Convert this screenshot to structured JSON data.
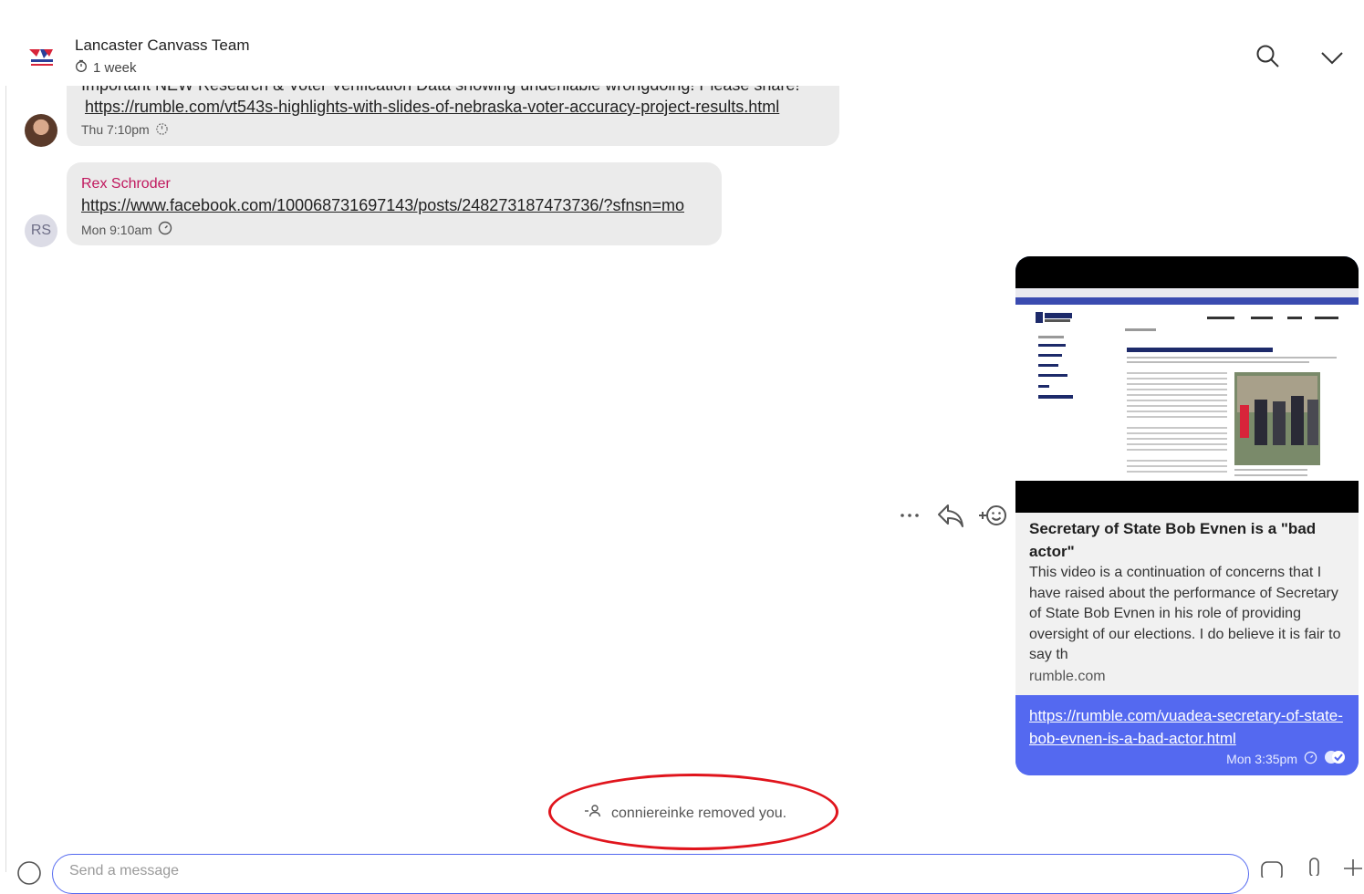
{
  "header": {
    "group_name": "Lancaster Canvass Team",
    "disappearing_timer": "1 week"
  },
  "messages": [
    {
      "text_partial": "Important NEW Research & Voter Verification Data showing undeniable wrongdoing! Please share!",
      "link": "https://rumble.com/vt543s-highlights-with-slides-of-nebraska-voter-accuracy-project-results.html",
      "time": "Thu 7:10pm"
    },
    {
      "sender": "Rex Schroder",
      "avatar_initials": "RS",
      "link": "https://www.facebook.com/100068731697143/posts/248273187473736/?sfnsn=mo",
      "time": "Mon 9:10am"
    }
  ],
  "outgoing": {
    "preview_title": "Secretary of State Bob Evnen is a \"bad actor\"",
    "preview_description": "This video is a continuation of concerns that I have raised about the performance of Secretary of State Bob Evnen in his role of providing oversight of our elections. I do believe it is fair to say th",
    "preview_domain": "rumble.com",
    "link": "https://rumble.com/vuadea-secretary-of-state-bob-evnen-is-a-bad-actor.html",
    "time": "Mon 3:35pm"
  },
  "system_notice": "conniereinke removed you.",
  "composer": {
    "placeholder": "Send a message"
  },
  "icons": {
    "search": "search-icon",
    "chevron": "chevron-down-icon",
    "more": "more-icon",
    "reply": "reply-icon",
    "react": "add-reaction-icon",
    "timer": "timer-icon",
    "delivered": "read-check-icon",
    "removed": "person-removed-icon",
    "emoji": "emoji-icon",
    "sticker": "sticker-icon",
    "mic": "mic-icon",
    "attach": "plus-icon"
  },
  "colors": {
    "accent": "#2c6bed",
    "link_bubble": "#5469f0",
    "sender_name": "#c0185e",
    "annotation": "#e0141c"
  }
}
